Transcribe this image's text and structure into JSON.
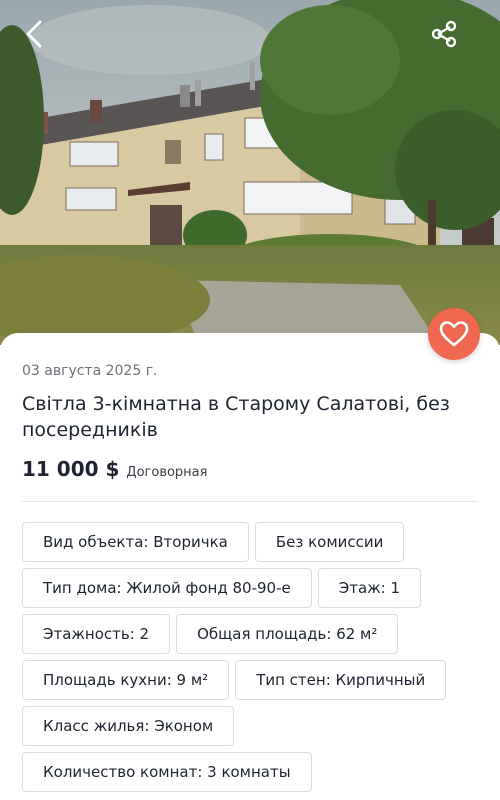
{
  "header": {
    "back_icon": "chevron-left-icon",
    "share_icon": "share-icon"
  },
  "photo": {
    "subject": "apartment-building-photo"
  },
  "favorite": {
    "icon": "heart-icon",
    "color": "#f0684f"
  },
  "listing": {
    "date": "03 августа 2025 г.",
    "title": "Світла 3-кімнатна в Старому Салатові, без посередників",
    "price": "11 000 $",
    "price_note": "Договорная"
  },
  "features": [
    "Вид объекта: Вторичка",
    "Без комиссии",
    "Тип дома: Жилой фонд 80-90-е",
    "Этаж: 1",
    "Этажность: 2",
    "Общая площадь: 62 м²",
    "Площадь кухни: 9 м²",
    "Тип стен: Кирпичный",
    "Класс жилья: Эконом",
    "Количество комнат: 3 комнаты"
  ],
  "colors": {
    "accent": "#f0684f",
    "text": "#1d2430",
    "muted": "#6c7078",
    "border": "#d9dce1"
  }
}
